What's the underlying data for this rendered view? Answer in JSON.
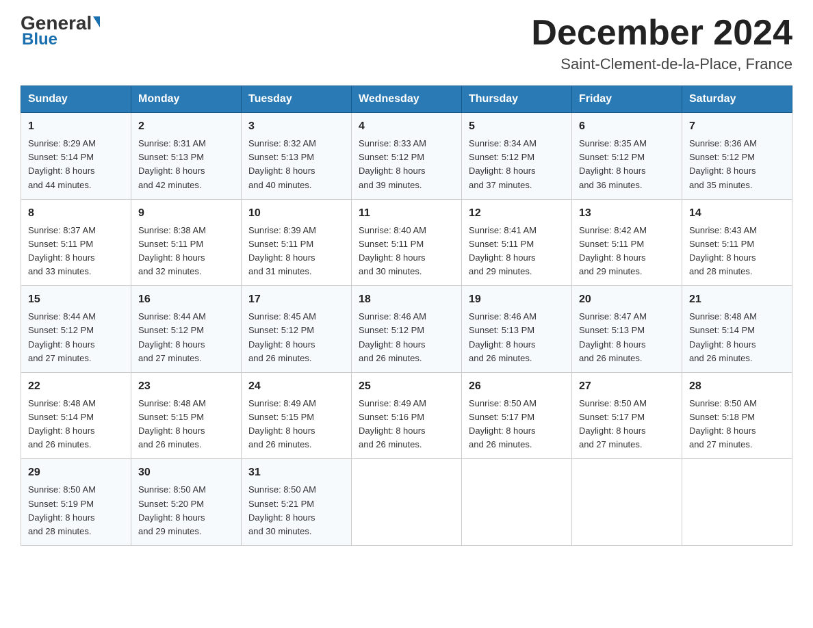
{
  "header": {
    "logo": {
      "general": "General",
      "blue": "Blue"
    },
    "title": "December 2024",
    "location": "Saint-Clement-de-la-Place, France"
  },
  "days_of_week": [
    "Sunday",
    "Monday",
    "Tuesday",
    "Wednesday",
    "Thursday",
    "Friday",
    "Saturday"
  ],
  "weeks": [
    [
      {
        "day": "1",
        "sunrise": "8:29 AM",
        "sunset": "5:14 PM",
        "daylight": "8 hours and 44 minutes."
      },
      {
        "day": "2",
        "sunrise": "8:31 AM",
        "sunset": "5:13 PM",
        "daylight": "8 hours and 42 minutes."
      },
      {
        "day": "3",
        "sunrise": "8:32 AM",
        "sunset": "5:13 PM",
        "daylight": "8 hours and 40 minutes."
      },
      {
        "day": "4",
        "sunrise": "8:33 AM",
        "sunset": "5:12 PM",
        "daylight": "8 hours and 39 minutes."
      },
      {
        "day": "5",
        "sunrise": "8:34 AM",
        "sunset": "5:12 PM",
        "daylight": "8 hours and 37 minutes."
      },
      {
        "day": "6",
        "sunrise": "8:35 AM",
        "sunset": "5:12 PM",
        "daylight": "8 hours and 36 minutes."
      },
      {
        "day": "7",
        "sunrise": "8:36 AM",
        "sunset": "5:12 PM",
        "daylight": "8 hours and 35 minutes."
      }
    ],
    [
      {
        "day": "8",
        "sunrise": "8:37 AM",
        "sunset": "5:11 PM",
        "daylight": "8 hours and 33 minutes."
      },
      {
        "day": "9",
        "sunrise": "8:38 AM",
        "sunset": "5:11 PM",
        "daylight": "8 hours and 32 minutes."
      },
      {
        "day": "10",
        "sunrise": "8:39 AM",
        "sunset": "5:11 PM",
        "daylight": "8 hours and 31 minutes."
      },
      {
        "day": "11",
        "sunrise": "8:40 AM",
        "sunset": "5:11 PM",
        "daylight": "8 hours and 30 minutes."
      },
      {
        "day": "12",
        "sunrise": "8:41 AM",
        "sunset": "5:11 PM",
        "daylight": "8 hours and 29 minutes."
      },
      {
        "day": "13",
        "sunrise": "8:42 AM",
        "sunset": "5:11 PM",
        "daylight": "8 hours and 29 minutes."
      },
      {
        "day": "14",
        "sunrise": "8:43 AM",
        "sunset": "5:11 PM",
        "daylight": "8 hours and 28 minutes."
      }
    ],
    [
      {
        "day": "15",
        "sunrise": "8:44 AM",
        "sunset": "5:12 PM",
        "daylight": "8 hours and 27 minutes."
      },
      {
        "day": "16",
        "sunrise": "8:44 AM",
        "sunset": "5:12 PM",
        "daylight": "8 hours and 27 minutes."
      },
      {
        "day": "17",
        "sunrise": "8:45 AM",
        "sunset": "5:12 PM",
        "daylight": "8 hours and 26 minutes."
      },
      {
        "day": "18",
        "sunrise": "8:46 AM",
        "sunset": "5:12 PM",
        "daylight": "8 hours and 26 minutes."
      },
      {
        "day": "19",
        "sunrise": "8:46 AM",
        "sunset": "5:13 PM",
        "daylight": "8 hours and 26 minutes."
      },
      {
        "day": "20",
        "sunrise": "8:47 AM",
        "sunset": "5:13 PM",
        "daylight": "8 hours and 26 minutes."
      },
      {
        "day": "21",
        "sunrise": "8:48 AM",
        "sunset": "5:14 PM",
        "daylight": "8 hours and 26 minutes."
      }
    ],
    [
      {
        "day": "22",
        "sunrise": "8:48 AM",
        "sunset": "5:14 PM",
        "daylight": "8 hours and 26 minutes."
      },
      {
        "day": "23",
        "sunrise": "8:48 AM",
        "sunset": "5:15 PM",
        "daylight": "8 hours and 26 minutes."
      },
      {
        "day": "24",
        "sunrise": "8:49 AM",
        "sunset": "5:15 PM",
        "daylight": "8 hours and 26 minutes."
      },
      {
        "day": "25",
        "sunrise": "8:49 AM",
        "sunset": "5:16 PM",
        "daylight": "8 hours and 26 minutes."
      },
      {
        "day": "26",
        "sunrise": "8:50 AM",
        "sunset": "5:17 PM",
        "daylight": "8 hours and 26 minutes."
      },
      {
        "day": "27",
        "sunrise": "8:50 AM",
        "sunset": "5:17 PM",
        "daylight": "8 hours and 27 minutes."
      },
      {
        "day": "28",
        "sunrise": "8:50 AM",
        "sunset": "5:18 PM",
        "daylight": "8 hours and 27 minutes."
      }
    ],
    [
      {
        "day": "29",
        "sunrise": "8:50 AM",
        "sunset": "5:19 PM",
        "daylight": "8 hours and 28 minutes."
      },
      {
        "day": "30",
        "sunrise": "8:50 AM",
        "sunset": "5:20 PM",
        "daylight": "8 hours and 29 minutes."
      },
      {
        "day": "31",
        "sunrise": "8:50 AM",
        "sunset": "5:21 PM",
        "daylight": "8 hours and 30 minutes."
      },
      null,
      null,
      null,
      null
    ]
  ],
  "labels": {
    "sunrise": "Sunrise:",
    "sunset": "Sunset:",
    "daylight": "Daylight:"
  }
}
